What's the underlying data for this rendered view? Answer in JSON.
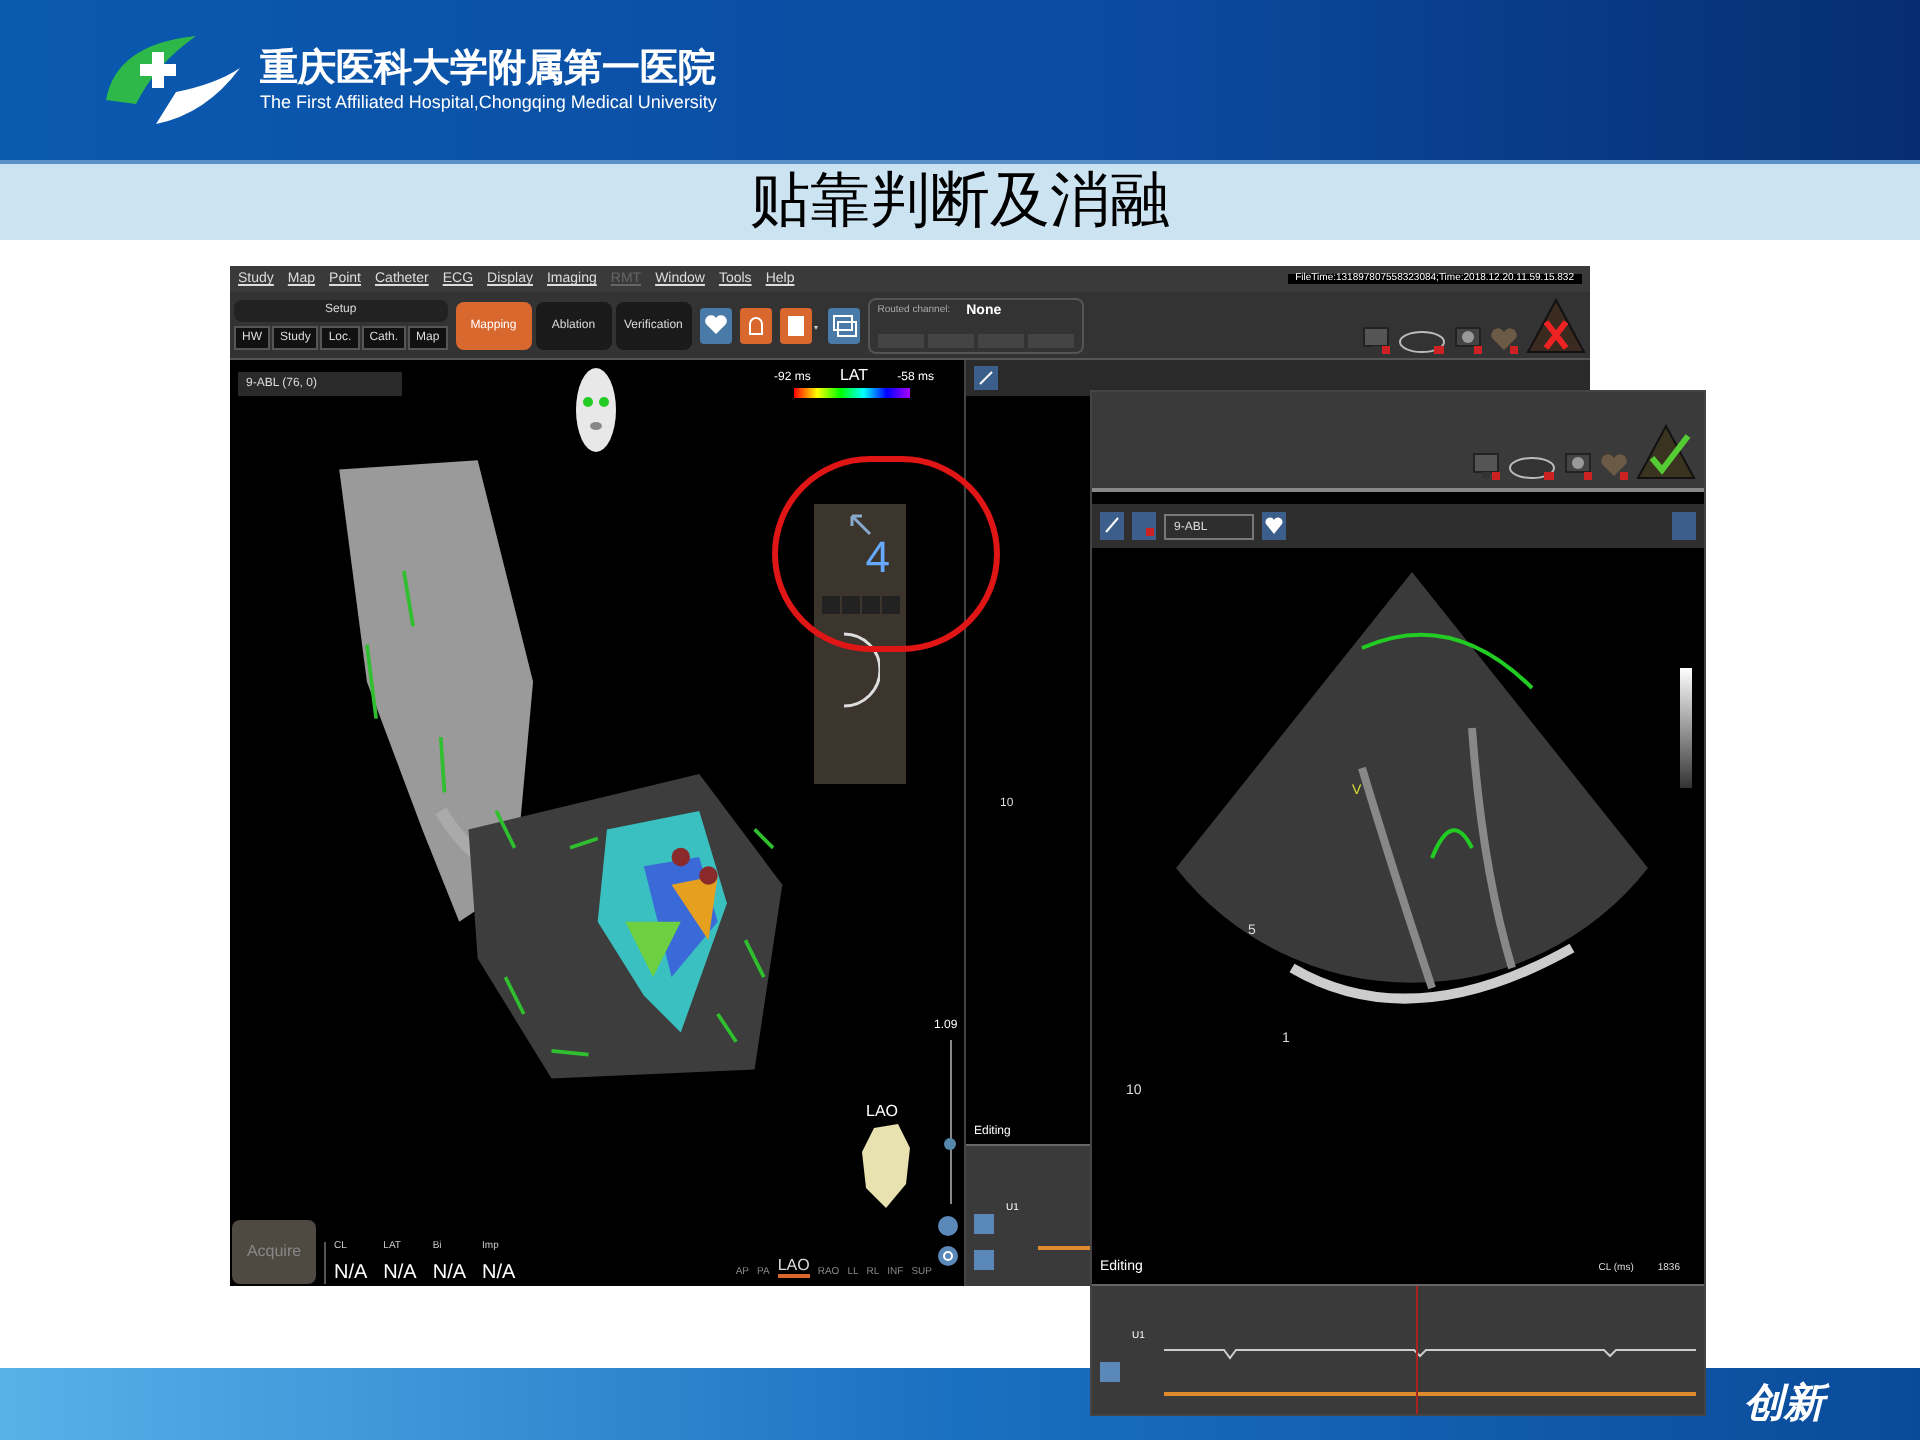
{
  "header": {
    "hospital_name": "重庆医科大学附属第一医院",
    "hospital_name_en": "The First Affiliated Hospital,Chongqing Medical University"
  },
  "slide_title": "贴靠判断及消融",
  "main_window": {
    "menu": [
      {
        "label": "Study",
        "disabled": false
      },
      {
        "label": "Map",
        "disabled": false
      },
      {
        "label": "Point",
        "disabled": false
      },
      {
        "label": "Catheter",
        "disabled": false
      },
      {
        "label": "ECG",
        "disabled": false
      },
      {
        "label": "Display",
        "disabled": false
      },
      {
        "label": "Imaging",
        "disabled": false
      },
      {
        "label": "RMT",
        "disabled": true
      },
      {
        "label": "Window",
        "disabled": false
      },
      {
        "label": "Tools",
        "disabled": false
      },
      {
        "label": "Help",
        "disabled": false
      }
    ],
    "file_time": "FileTime:131897807558323084;Time:2018.12.20.11.59.15.832",
    "setup_label": "Setup",
    "setup_tabs": [
      "HW",
      "Study",
      "Loc.",
      "Cath.",
      "Map"
    ],
    "modes": [
      {
        "label": "Mapping",
        "selected": true
      },
      {
        "label": "Ablation",
        "selected": false
      },
      {
        "label": "Verification",
        "selected": false
      }
    ],
    "routed_channel": {
      "label": "Routed channel:",
      "value": "None"
    },
    "catheter_select": "9-ABL (76, 0)",
    "lat_legend": {
      "min": "-92 ms",
      "title": "LAT",
      "max": "-58 ms"
    },
    "force_value": "4",
    "zoom_value": "1.09",
    "zoom": {
      "level": 0.35
    },
    "orientation_label": "LAO",
    "views": [
      {
        "label": "AP",
        "selected": false
      },
      {
        "label": "PA",
        "selected": false
      },
      {
        "label": "LAO",
        "selected": true
      },
      {
        "label": "RAO",
        "selected": false
      },
      {
        "label": "LL",
        "selected": false
      },
      {
        "label": "RL",
        "selected": false
      },
      {
        "label": "INF",
        "selected": false
      },
      {
        "label": "SUP",
        "selected": false
      }
    ],
    "acquire": {
      "label": "Acquire",
      "disabled": true
    },
    "metrics": [
      {
        "label": "CL",
        "value": "N/A"
      },
      {
        "label": "LAT",
        "value": "N/A"
      },
      {
        "label": "Bi",
        "value": "N/A"
      },
      {
        "label": "Imp",
        "value": "N/A"
      }
    ],
    "side_panel": {
      "marker": "10",
      "editing": "Editing",
      "channel": "U1"
    }
  },
  "echo_window": {
    "catheter_select": "9-ABL",
    "labels": [
      "V",
      "5",
      "1",
      "10"
    ],
    "editing": "Editing",
    "cl_label": "CL (ms)",
    "cl_value": "1836",
    "channel": "U1"
  },
  "footer_text": "创新"
}
